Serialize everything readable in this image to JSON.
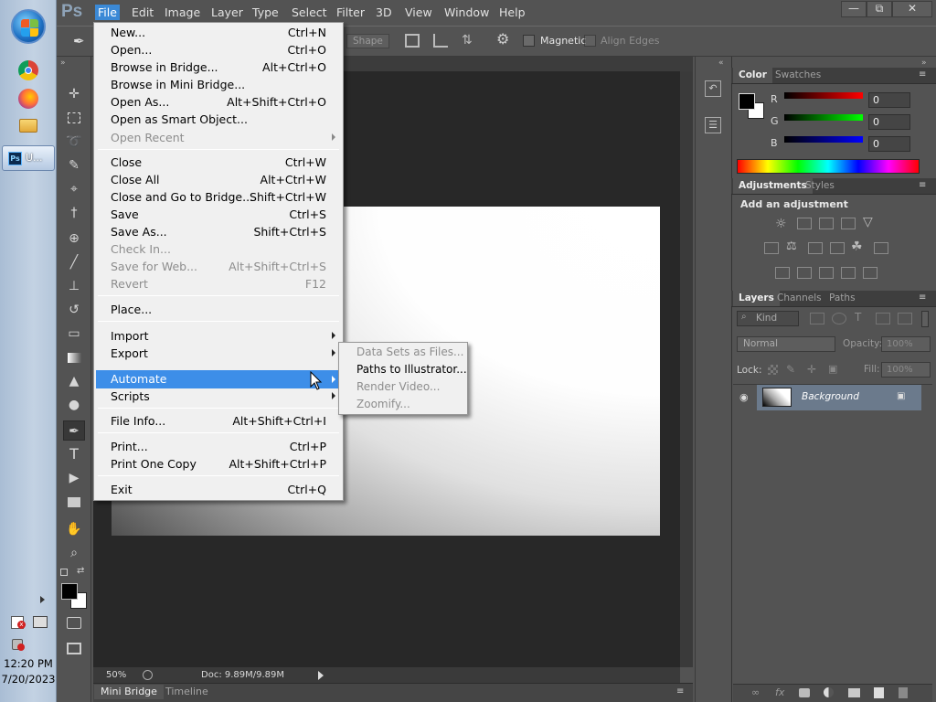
{
  "taskbar": {
    "clock_time": "12:20 PM",
    "clock_date": "7/20/2023",
    "ps_button_label": "U..."
  },
  "app": {
    "logo": "Ps",
    "menus": [
      "File",
      "Edit",
      "Image",
      "Layer",
      "Type",
      "Select",
      "Filter",
      "3D",
      "View",
      "Window",
      "Help"
    ],
    "active_menu": "File",
    "window_controls": [
      "—",
      "⧉",
      "✕"
    ]
  },
  "options": {
    "shape_label": "Shape",
    "magnetic_label": "Magnetic",
    "align_edges_label": "Align Edges"
  },
  "status": {
    "zoom": "50%",
    "doc_info": "Doc: 9.89M/9.89M"
  },
  "bottom_tabs": [
    "Mini Bridge",
    "Timeline"
  ],
  "color_panel": {
    "tabs": [
      "Color",
      "Swatches"
    ],
    "channels": [
      {
        "label": "R",
        "value": "0",
        "color": "#e02020"
      },
      {
        "label": "G",
        "value": "0",
        "color": "#20c020"
      },
      {
        "label": "B",
        "value": "0",
        "color": "#2030e0"
      }
    ]
  },
  "adjustments_panel": {
    "tabs": [
      "Adjustments",
      "Styles"
    ],
    "heading": "Add an adjustment"
  },
  "layers_panel": {
    "tabs": [
      "Layers",
      "Channels",
      "Paths"
    ],
    "kind_label": "Kind",
    "blend_mode": "Normal",
    "opacity_label": "Opacity:",
    "opacity_value": "100%",
    "lock_label": "Lock:",
    "fill_label": "Fill:",
    "fill_value": "100%",
    "layer_name": "Background"
  },
  "file_menu": {
    "items": [
      {
        "label": "New...",
        "shortcut": "Ctrl+N",
        "enabled": true
      },
      {
        "label": "Open...",
        "shortcut": "Ctrl+O",
        "enabled": true
      },
      {
        "label": "Browse in Bridge...",
        "shortcut": "Alt+Ctrl+O",
        "enabled": true
      },
      {
        "label": "Browse in Mini Bridge...",
        "shortcut": "",
        "enabled": true
      },
      {
        "label": "Open As...",
        "shortcut": "Alt+Shift+Ctrl+O",
        "enabled": true
      },
      {
        "label": "Open as Smart Object...",
        "shortcut": "",
        "enabled": true
      },
      {
        "label": "Open Recent",
        "shortcut": "",
        "enabled": false,
        "submenu": true
      },
      {
        "label": "Close",
        "shortcut": "Ctrl+W",
        "enabled": true
      },
      {
        "label": "Close All",
        "shortcut": "Alt+Ctrl+W",
        "enabled": true
      },
      {
        "label": "Close and Go to Bridge...",
        "shortcut": "Shift+Ctrl+W",
        "enabled": true
      },
      {
        "label": "Save",
        "shortcut": "Ctrl+S",
        "enabled": true
      },
      {
        "label": "Save As...",
        "shortcut": "Shift+Ctrl+S",
        "enabled": true
      },
      {
        "label": "Check In...",
        "shortcut": "",
        "enabled": false
      },
      {
        "label": "Save for Web...",
        "shortcut": "Alt+Shift+Ctrl+S",
        "enabled": false
      },
      {
        "label": "Revert",
        "shortcut": "F12",
        "enabled": false
      },
      {
        "label": "Place...",
        "shortcut": "",
        "enabled": true
      },
      {
        "label": "Import",
        "shortcut": "",
        "enabled": true,
        "submenu": true
      },
      {
        "label": "Export",
        "shortcut": "",
        "enabled": true,
        "submenu": true
      },
      {
        "label": "Automate",
        "shortcut": "",
        "enabled": true,
        "submenu": true,
        "highlighted": true
      },
      {
        "label": "Scripts",
        "shortcut": "",
        "enabled": true,
        "submenu": true
      },
      {
        "label": "File Info...",
        "shortcut": "Alt+Shift+Ctrl+I",
        "enabled": true
      },
      {
        "label": "Print...",
        "shortcut": "Ctrl+P",
        "enabled": true
      },
      {
        "label": "Print One Copy",
        "shortcut": "Alt+Shift+Ctrl+P",
        "enabled": true
      },
      {
        "label": "Exit",
        "shortcut": "Ctrl+Q",
        "enabled": true
      }
    ]
  },
  "automate_submenu": {
    "items": [
      {
        "label": "Data Sets as Files...",
        "enabled": false
      },
      {
        "label": "Paths to Illustrator...",
        "enabled": true
      },
      {
        "label": "Render Video...",
        "enabled": false
      },
      {
        "label": "Zoomify...",
        "enabled": false
      }
    ]
  }
}
